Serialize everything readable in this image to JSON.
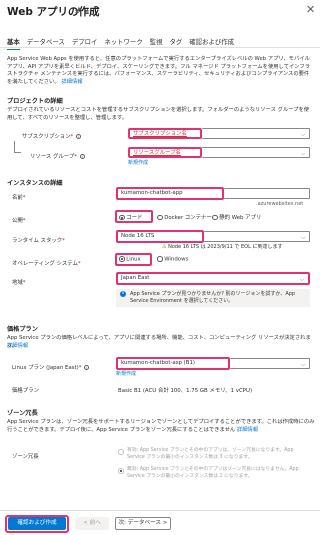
{
  "header": {
    "title": "Web アプリの作成",
    "more_label": "…",
    "close_label": "✕"
  },
  "tabs": [
    "基本",
    "データベース",
    "デプロイ",
    "ネットワーク",
    "監視",
    "タグ",
    "確認および作成"
  ],
  "intro": {
    "text": "App Service Web Apps を使用すると、任意のプラットフォームで実行するエンタープライズレベルの Web アプリ、モバイル アプリ、API アプリを素早くビルド、デプロイ、スケーリングできます。フル マネージド プラットフォームを使用してインフラストラクチャ メンテナンスを実行するには、パフォーマンス、スケーラビリティ、セキュリティおよびコンプライアンスの要件を満たしてください。",
    "link": "詳細情報"
  },
  "project": {
    "heading": "プロジェクトの詳細",
    "desc": "デプロイされているリソースとコストを管理するサブスクリプションを選択します。フォルダーのようなリソース グループを使用して、すべてのリソースを整理し、管理します。",
    "subscription_label": "サブスクリプション",
    "subscription_value": "サブスクリプション名",
    "resource_group_label": "リソース グループ",
    "resource_group_value": "リソースグループ名",
    "create_new": "新規作成"
  },
  "instance": {
    "heading": "インスタンスの詳細",
    "name_label": "名前",
    "name_value": "kumamon-chatbot-app",
    "name_suffix": ".azurewebsites.net",
    "publish_label": "公開",
    "publish_options": [
      "コード",
      "Docker コンテナー",
      "静的 Web アプリ"
    ],
    "runtime_label": "ランタイム スタック",
    "runtime_value": "Node 16 LTS",
    "runtime_warning": "Node 16 LTS は 2023/9/11 で EOL に到達します",
    "os_label": "オペレーティング システム",
    "os_options": [
      "Linux",
      "Windows"
    ],
    "region_label": "地域",
    "region_value": "Japan East",
    "region_note": "App Service プランが見つかりませんか? 別のリージョンを試すか、App Service Environment を選択してください。"
  },
  "pricing": {
    "heading": "価格プラン",
    "desc": "App Service プランの価格レベルによって、アプリに関連する場所、機能、コスト、コンピューティング リソースが決定されます。",
    "link": "詳細情報",
    "plan_label": "Linux プラン (Japan East)",
    "plan_value": "kumamon-chatbot-asp (B1)",
    "create_new": "新規作成",
    "pricing_label": "価格プラン",
    "pricing_value": "Basic B1 (ACU 合計 100、1.75 GB メモリ、1 vCPU)"
  },
  "zone": {
    "heading": "ゾーン冗長",
    "desc": "App Service プランは、ゾーン冗長をサポートするリージョンでゾーンとしてデプロイすることができます。これは作成時にのみ行うことができます。デプロイ後に、App Service プランをゾーン冗長にすることはできません",
    "link": "詳細情報",
    "label": "ゾーン冗長",
    "opt1": "有効: App Service プランとその中のアプリは、ゾーン冗長になります。App Service プランの最小のインスタンス数は 3 になります。",
    "opt2": "無効: App Service プランとその中のアプリはゾーン冗長にはなりません。App Service プランの最小のインスタンス数は 1 になります。"
  },
  "footer": {
    "review_button": "確認および作成",
    "prev_button": "< 前へ",
    "next_button": "次: データベース >"
  },
  "colors": {
    "accent": "#0078d4",
    "highlight": "#e3336e",
    "warning": "#986f0b"
  }
}
